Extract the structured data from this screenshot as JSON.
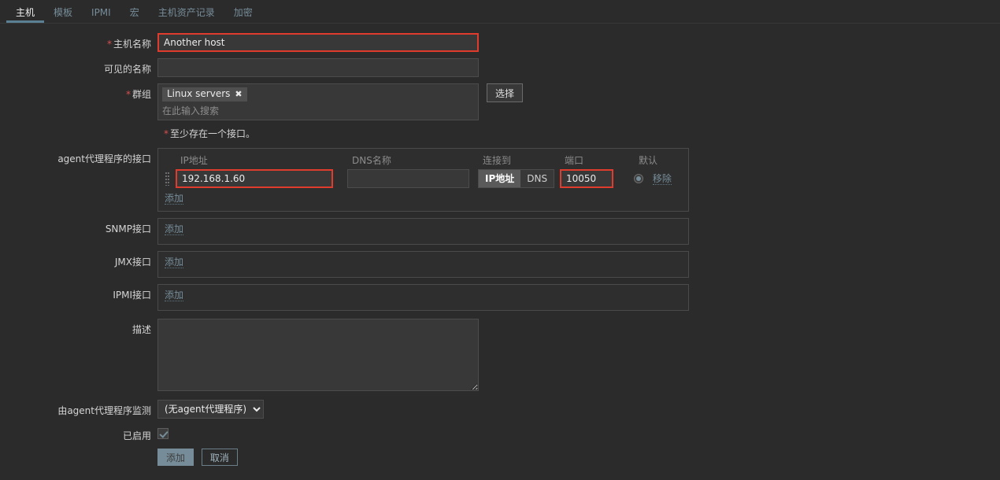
{
  "tabs": [
    {
      "label": "主机",
      "active": true
    },
    {
      "label": "模板",
      "active": false
    },
    {
      "label": "IPMI",
      "active": false
    },
    {
      "label": "宏",
      "active": false
    },
    {
      "label": "主机资产记录",
      "active": false
    },
    {
      "label": "加密",
      "active": false
    }
  ],
  "form": {
    "host_name": {
      "label": "主机名称",
      "value": "Another host",
      "required": true
    },
    "visible_name": {
      "label": "可见的名称",
      "value": "",
      "placeholder": ""
    },
    "groups": {
      "label": "群组",
      "required": true,
      "chips": [
        "Linux servers"
      ],
      "chip_remove_glyph": "✖",
      "placeholder": "在此输入搜索",
      "select_button": "选择"
    },
    "interface_hint": "至少存在一个接口。",
    "agent_interface": {
      "label": "agent代理程序的接口",
      "headers": {
        "ip": "IP地址",
        "dns": "DNS名称",
        "connect_to": "连接到",
        "port": "端口",
        "default": "默认"
      },
      "rows": [
        {
          "ip": "192.168.1.60",
          "dns": "",
          "connect_to_options": [
            "IP地址",
            "DNS"
          ],
          "connect_to_selected": "IP地址",
          "port": "10050",
          "default_checked": true,
          "remove_label": "移除"
        }
      ],
      "add_label": "添加"
    },
    "snmp_interface": {
      "label": "SNMP接口",
      "add_label": "添加"
    },
    "jmx_interface": {
      "label": "JMX接口",
      "add_label": "添加"
    },
    "ipmi_interface": {
      "label": "IPMI接口",
      "add_label": "添加"
    },
    "description": {
      "label": "描述",
      "value": ""
    },
    "monitored_by_proxy": {
      "label": "由agent代理程序监测",
      "selected": "(无agent代理程序)",
      "options": [
        "(无agent代理程序)"
      ]
    },
    "enabled": {
      "label": "已启用",
      "checked": true
    },
    "buttons": {
      "submit": "添加",
      "cancel": "取消"
    }
  },
  "colors": {
    "accent_link": "#768d99",
    "required_asterisk": "#d64e4e",
    "highlight_border": "#e03c2e",
    "background": "#2b2b2b"
  }
}
